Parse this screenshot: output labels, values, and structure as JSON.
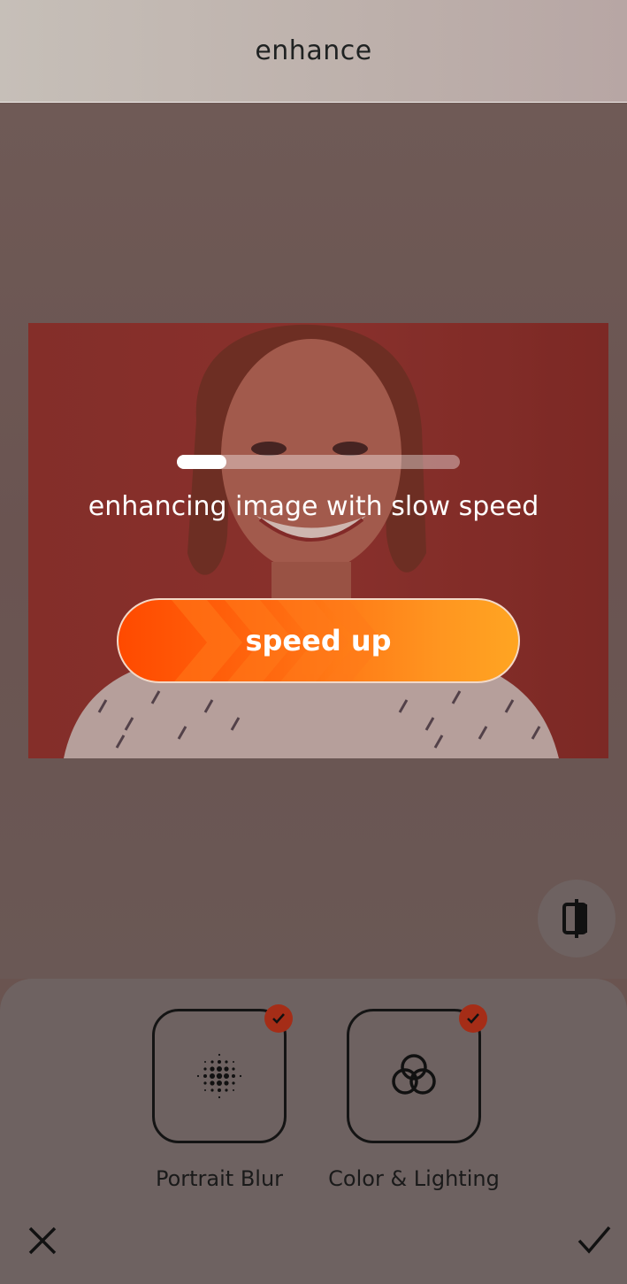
{
  "header": {
    "title": "enhance"
  },
  "enhance": {
    "status_text": "enhancing image with slow speed",
    "progress_fraction": 0.175,
    "speed_up_label": "speed up"
  },
  "tools": [
    {
      "label": "Portrait Blur",
      "icon": "dots-grid-icon",
      "checked": true
    },
    {
      "label": "Color & Lighting",
      "icon": "overlapping-circles-icon",
      "checked": true
    }
  ],
  "icons": {
    "compare": "compare-split-icon",
    "close": "close-icon",
    "confirm": "checkmark-icon"
  },
  "colors": {
    "accent_start": "#ff4a00",
    "accent_end": "#ffa522",
    "badge": "#a52d17"
  }
}
